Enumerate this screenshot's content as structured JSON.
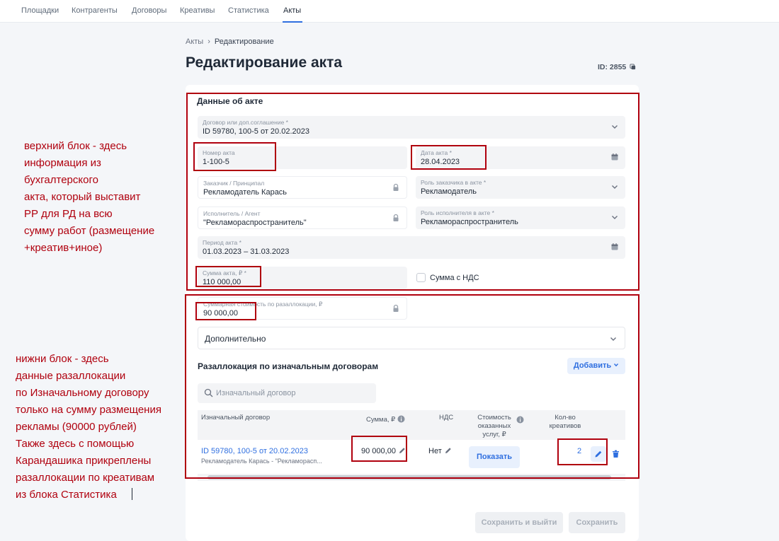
{
  "nav": {
    "items": [
      "Площадки",
      "Контрагенты",
      "Договоры",
      "Креативы",
      "Статистика",
      "Акты"
    ],
    "active_index": 5
  },
  "breadcrumb": {
    "parent": "Акты",
    "current": "Редактирование"
  },
  "page": {
    "title": "Редактирование акта",
    "id_label": "ID: 2855"
  },
  "act": {
    "section_title": "Данные об акте",
    "contract": {
      "label": "Договор или доп.соглашение *",
      "value": "ID 59780, 100-5 от 20.02.2023"
    },
    "act_number": {
      "label": "Номер акта",
      "value": "1-100-5"
    },
    "act_date": {
      "label": "Дата акта *",
      "value": "28.04.2023"
    },
    "customer": {
      "label": "Заказчик / Принципал",
      "value": "Рекламодатель Карась"
    },
    "customer_role": {
      "label": "Роль заказчика в акте *",
      "value": "Рекламодатель"
    },
    "executor": {
      "label": "Исполнитель / Агент",
      "value": "\"Рекламораспространитель\""
    },
    "executor_role": {
      "label": "Роль исполнителя в акте *",
      "value": "Рекламораспространитель"
    },
    "period": {
      "label": "Период акта *",
      "value": "01.03.2023 – 31.03.2023"
    },
    "amount": {
      "label": "Сумма акта, ₽ *",
      "value": "110 000,00"
    },
    "vat_checkbox_label": "Сумма с НДС",
    "vat_checked": false,
    "realloc_total": {
      "label": "Суммарная стоимость по разаллокации, ₽",
      "value": "90 000,00"
    },
    "additional_label": "Дополнительно"
  },
  "realloc": {
    "title": "Разаллокация по изначальным договорам",
    "add_button": "Добавить",
    "search_placeholder": "Изначальный договор",
    "columns": {
      "contract": "Изначальный договор",
      "sum": "Сумма, ₽",
      "vat": "НДС",
      "cost_line1": "Стоимость",
      "cost_line2": "оказанных",
      "cost_line3": "услуг, ₽",
      "count_line1": "Кол-во",
      "count_line2": "креативов"
    },
    "rows": [
      {
        "contract": "ID 59780, 100-5 от 20.02.2023",
        "parties": "Рекламодатель Карась - \"Рекламорасп...",
        "sum": "90 000,00",
        "vat": "Нет",
        "cost_button": "Показать",
        "creatives_count": "2"
      }
    ]
  },
  "footer": {
    "save_exit": "Сохранить и выйти",
    "save": "Сохранить"
  },
  "annotations": {
    "top_block": "верхний блок - здесь\nинформация из\nбухгалтерского\nакта, который выставит\nРР для РД на всю\nсумму работ (размещение\n+креатив+иное)",
    "bottom_block": "нижни блок - здесь\nданные разаллокации\nпо Изначальному договору\nтолько на сумму размещения\nрекламы (90000 рублей)\nТакже здесь с помощью\nКарандашика прикреплены\nразаллокации по креативам\nиз блока Статистика"
  },
  "colors": {
    "accent": "#2f6fe0",
    "annotation_red": "#b0000e",
    "field_bg": "#f3f4f6"
  }
}
